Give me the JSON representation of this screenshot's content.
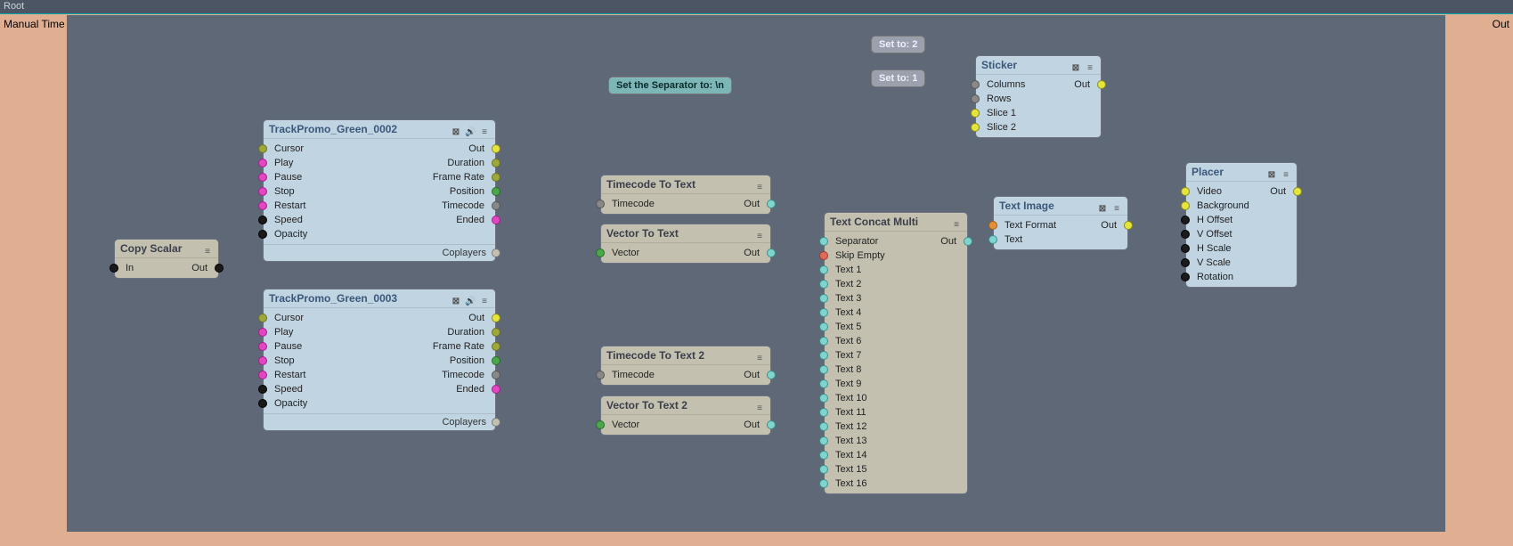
{
  "root_label": "Root",
  "ext_in": {
    "label": "Manual Time"
  },
  "ext_out": {
    "label": "Out"
  },
  "anno_sep": "Set the Separator to: \\n",
  "anno_col": "Set to: 2",
  "anno_row": "Set to: 1",
  "copy_scalar": {
    "title": "Copy Scalar",
    "in": "In",
    "out": "Out"
  },
  "track1": {
    "title": "TrackPromo_Green_0002",
    "left": [
      "Cursor",
      "Play",
      "Pause",
      "Stop",
      "Restart",
      "Speed",
      "Opacity"
    ],
    "right": [
      "Out",
      "Duration",
      "Frame Rate",
      "Position",
      "Timecode",
      "Ended"
    ],
    "footer": "Coplayers"
  },
  "track2": {
    "title": "TrackPromo_Green_0003",
    "left": [
      "Cursor",
      "Play",
      "Pause",
      "Stop",
      "Restart",
      "Speed",
      "Opacity"
    ],
    "right": [
      "Out",
      "Duration",
      "Frame Rate",
      "Position",
      "Timecode",
      "Ended"
    ],
    "footer": "Coplayers"
  },
  "tc1": {
    "title": "Timecode To Text",
    "in": "Timecode",
    "out": "Out"
  },
  "vt1": {
    "title": "Vector To Text",
    "in": "Vector",
    "out": "Out"
  },
  "tc2": {
    "title": "Timecode To Text 2",
    "in": "Timecode",
    "out": "Out"
  },
  "vt2": {
    "title": "Vector To Text 2",
    "in": "Vector",
    "out": "Out"
  },
  "concat": {
    "title": "Text Concat Multi",
    "out": "Out",
    "inputs": [
      "Separator",
      "Skip Empty",
      "Text 1",
      "Text 2",
      "Text 3",
      "Text 4",
      "Text 5",
      "Text 6",
      "Text 7",
      "Text 8",
      "Text 9",
      "Text 10",
      "Text 11",
      "Text 12",
      "Text 13",
      "Text 14",
      "Text 15",
      "Text 16"
    ]
  },
  "textimg": {
    "title": "Text Image",
    "in": [
      "Text Format",
      "Text"
    ],
    "out": "Out"
  },
  "sticker": {
    "title": "Sticker",
    "in": [
      "Columns",
      "Rows",
      "Slice 1",
      "Slice 2"
    ],
    "out": "Out"
  },
  "placer": {
    "title": "Placer",
    "in": [
      "Video",
      "Background",
      "H Offset",
      "V Offset",
      "H Scale",
      "V Scale",
      "Rotation"
    ],
    "out": "Out"
  }
}
